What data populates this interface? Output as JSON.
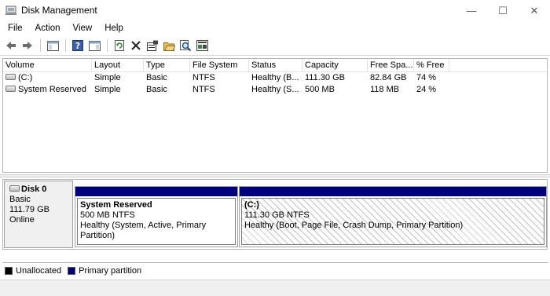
{
  "window": {
    "title": "Disk Management",
    "controls": {
      "minimize": "—",
      "maximize": "☐",
      "close": "✕"
    }
  },
  "menu": {
    "items": [
      "File",
      "Action",
      "View",
      "Help"
    ]
  },
  "toolbar": {
    "icons": [
      "back-icon",
      "forward-icon",
      "show-hide-console-tree-icon",
      "help-icon",
      "show-action-pane-icon",
      "refresh-icon",
      "delete-icon",
      "properties-icon",
      "open-icon",
      "explore-icon",
      "rescan-disks-icon"
    ]
  },
  "volume_list": {
    "columns": [
      "Volume",
      "Layout",
      "Type",
      "File System",
      "Status",
      "Capacity",
      "Free Spa...",
      "% Free"
    ],
    "rows": [
      {
        "volume": "(C:)",
        "layout": "Simple",
        "type": "Basic",
        "fs": "NTFS",
        "status": "Healthy (B...",
        "capacity": "111.30 GB",
        "free": "82.84 GB",
        "pct": "74 %"
      },
      {
        "volume": "System Reserved",
        "layout": "Simple",
        "type": "Basic",
        "fs": "NTFS",
        "status": "Healthy (S...",
        "capacity": "500 MB",
        "free": "118 MB",
        "pct": "24 %"
      }
    ]
  },
  "disk": {
    "name": "Disk 0",
    "type": "Basic",
    "size": "111.79 GB",
    "state": "Online",
    "partitions": [
      {
        "name": "System Reserved",
        "size_fs": "500 MB NTFS",
        "status": "Healthy (System, Active, Primary Partition)"
      },
      {
        "name": "(C:)",
        "size_fs": "111.30 GB NTFS",
        "status": "Healthy (Boot, Page File, Crash Dump, Primary Partition)"
      }
    ]
  },
  "legend": {
    "items": [
      {
        "label": "Unallocated",
        "color": "#000000"
      },
      {
        "label": "Primary partition",
        "color": "#00007f"
      }
    ]
  }
}
